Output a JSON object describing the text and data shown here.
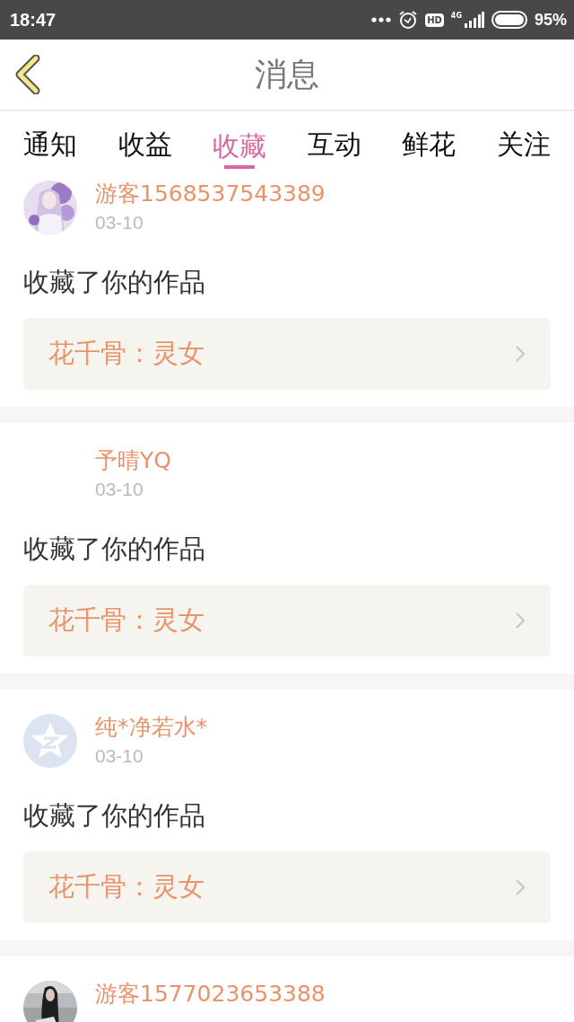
{
  "status_bar": {
    "time": "18:47",
    "network": "4G",
    "hd": "HD",
    "battery": "95%"
  },
  "header": {
    "title": "消息"
  },
  "tabs": [
    {
      "label": "通知",
      "selected": false
    },
    {
      "label": "收益",
      "selected": false
    },
    {
      "label": "收藏",
      "selected": true
    },
    {
      "label": "互动",
      "selected": false
    },
    {
      "label": "鲜花",
      "selected": false
    },
    {
      "label": "关注",
      "selected": false
    }
  ],
  "messages": [
    {
      "name": "游客1568537543389",
      "date": "03-10",
      "text": "收藏了你的作品",
      "work": "花千骨：灵女"
    },
    {
      "name": "予晴YQ",
      "date": "03-10",
      "text": "收藏了你的作品",
      "work": "花千骨：灵女"
    },
    {
      "avatar": {
        "kind": "star"
      },
      "name": "纯*净若水*",
      "date": "03-10",
      "text": "收藏了你的作品",
      "work": "花千骨：灵女"
    },
    {
      "name": "游客1577023653388"
    }
  ]
}
